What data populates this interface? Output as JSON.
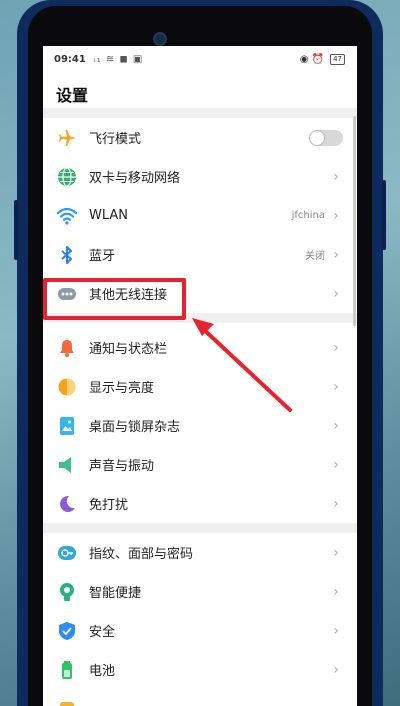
{
  "status_bar": {
    "time": "09:41",
    "signal_text": "ᵢ₁ ≋ ◼ ▣",
    "right_icons_text": "◉ ⏰",
    "battery": "47"
  },
  "page_title": "设置",
  "groups": [
    {
      "items": [
        {
          "label": "飞行模式",
          "icon": "airplane-icon",
          "type": "toggle",
          "toggle_on": false
        },
        {
          "label": "双卡与移动网络",
          "icon": "globe-icon",
          "type": "chevron"
        },
        {
          "label": "WLAN",
          "icon": "wifi-icon",
          "type": "chevron",
          "value": "jfchina"
        },
        {
          "label": "蓝牙",
          "icon": "bluetooth-icon",
          "type": "chevron",
          "value": "关闭"
        },
        {
          "label": "其他无线连接",
          "icon": "more-dots-icon",
          "type": "chevron"
        }
      ]
    },
    {
      "items": [
        {
          "label": "通知与状态栏",
          "icon": "bell-icon",
          "type": "chevron"
        },
        {
          "label": "显示与亮度",
          "icon": "brightness-icon",
          "type": "chevron"
        },
        {
          "label": "桌面与锁屏杂志",
          "icon": "wallpaper-icon",
          "type": "chevron"
        },
        {
          "label": "声音与振动",
          "icon": "speaker-icon",
          "type": "chevron"
        },
        {
          "label": "免打扰",
          "icon": "moon-icon",
          "type": "chevron"
        }
      ]
    },
    {
      "items": [
        {
          "label": "指纹、面部与密码",
          "icon": "fingerprint-icon",
          "type": "chevron"
        },
        {
          "label": "智能便捷",
          "icon": "smart-assist-icon",
          "type": "chevron"
        },
        {
          "label": "安全",
          "icon": "shield-icon",
          "type": "chevron"
        },
        {
          "label": "电池",
          "icon": "battery-icon",
          "type": "chevron"
        }
      ]
    }
  ],
  "chevron_glyph": "›",
  "colors": {
    "airplane": "#f5a623",
    "globe": "#2db36b",
    "wifi": "#2b9af3",
    "bluetooth": "#2f7fe6",
    "more": "#8a9aa8",
    "bell": "#f26b3a",
    "brightness": "#f7a21b",
    "wallpaper": "#35b5e8",
    "speaker": "#3fbf8a",
    "moon": "#8a5ad6",
    "fingerprint": "#2fa8d8",
    "smart": "#26b27a",
    "shield": "#2b8ef0",
    "battery": "#2fc26a",
    "highlight": "#e8232d"
  }
}
